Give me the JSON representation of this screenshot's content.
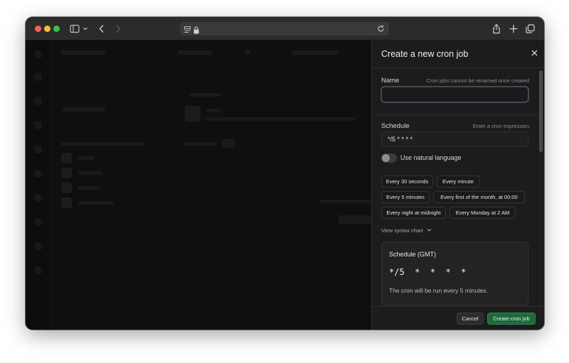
{
  "browser": {
    "url": "",
    "toolbar_icons": [
      "sidebar-icon",
      "chevron-down-icon",
      "back-icon",
      "forward-icon",
      "site-icon",
      "lock-icon",
      "reload-icon",
      "share-icon",
      "new-tab-icon",
      "tabs-icon"
    ]
  },
  "panel": {
    "title": "Create a new cron job",
    "name": {
      "label": "Name",
      "hint": "Cron jobs cannot be renamed once created",
      "value": ""
    },
    "schedule": {
      "label": "Schedule",
      "hint": "Enter a cron expression",
      "value": "*/5 * * * *"
    },
    "natural_language": {
      "label": "Use natural language",
      "enabled": false
    },
    "presets": [
      "Every 30 seconds",
      "Every minute",
      "Every 5 minutes",
      "Every first of the month, at 00:00",
      "Every night at midnight",
      "Every Monday at 2 AM"
    ],
    "syntax_link": "View syntax chart",
    "preview": {
      "title": "Schedule (GMT)",
      "expression": "*/5 * * * *",
      "description": "The cron will be run every 5 minutes."
    },
    "footer": {
      "cancel_label": "Cancel",
      "create_label": "Create cron job"
    }
  },
  "colors": {
    "primary_button": "#1b6b3e",
    "panel_background": "#1c1c1c"
  }
}
